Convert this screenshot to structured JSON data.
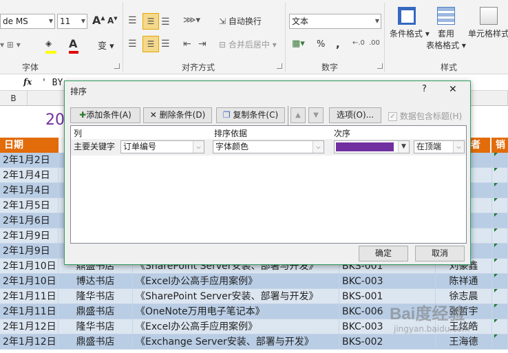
{
  "ribbon": {
    "font_name": "de MS",
    "font_size": "11",
    "wrap_text": "自动换行",
    "merge_center": "合并后居中",
    "number_format": "文本",
    "groups": {
      "font": "字体",
      "alignment": "对齐方式",
      "number": "数字",
      "styles": "样式"
    },
    "styles_buttons": {
      "conditional": "条件格式",
      "table_1": "套用",
      "table_2": "表格格式",
      "cell_styles": "单元格样式"
    },
    "grow_font": "A",
    "shrink_font": "A",
    "font_color_letter": "A",
    "percent": "%",
    "comma": ","
  },
  "formula_bar": {
    "fx": "fx",
    "content": "' BY-"
  },
  "sheet": {
    "col_b": "B",
    "title_partial": "20",
    "header_left": "日期",
    "header_right_partial_1": "者",
    "header_right_partial_2": "销",
    "rows": [
      {
        "date": "2年1月2日"
      },
      {
        "date": "2年1月4日"
      },
      {
        "date": "2年1月4日"
      },
      {
        "date": "2年1月5日"
      },
      {
        "date": "2年1月6日"
      },
      {
        "date": "2年1月9日"
      },
      {
        "date": "2年1月9日"
      },
      {
        "date": "2年1月10日",
        "store": "鼎盛书店",
        "book": "《SharePoint Server安装、部署与开发》",
        "code": "BKS-001",
        "person": "刘豪鑫"
      },
      {
        "date": "2年1月10日",
        "store": "博达书店",
        "book": "《Excel办公高手应用案例》",
        "code": "BKC-003",
        "person": "陈祥通"
      },
      {
        "date": "2年1月11日",
        "store": "隆华书店",
        "book": "《SharePoint Server安装、部署与开发》",
        "code": "BKS-001",
        "person": "徐志晨"
      },
      {
        "date": "2年1月11日",
        "store": "鼎盛书店",
        "book": "《OneNote万用电子笔记本》",
        "code": "BKC-006",
        "person": "张哲宇"
      },
      {
        "date": "2年1月12日",
        "store": "隆华书店",
        "book": "《Excel办公高手应用案例》",
        "code": "BKC-003",
        "person": "王炫皓"
      },
      {
        "date": "2年1月12日",
        "store": "鼎盛书店",
        "book": "《Exchange Server安装、部署与开发》",
        "code": "BKS-002",
        "person": "王海德"
      }
    ]
  },
  "dialog": {
    "title": "排序",
    "help": "?",
    "close": "✕",
    "add_level": "添加条件(A)",
    "delete_level": "删除条件(D)",
    "copy_level": "复制条件(C)",
    "move_up": "▲",
    "move_down": "▼",
    "options": "选项(O)...",
    "has_headers": "数据包含标题(H)",
    "col_header": "列",
    "sort_on_header": "排序依据",
    "order_header": "次序",
    "primary_key_label": "主要关键字",
    "column_value": "订单编号",
    "sort_on_value": "字体颜色",
    "color_swatch": "#7030a0",
    "position_value": "在顶端",
    "ok": "确定",
    "cancel": "取消"
  },
  "watermark": {
    "brand": "Bai度经验",
    "url": "jingyan.baidu.com"
  }
}
